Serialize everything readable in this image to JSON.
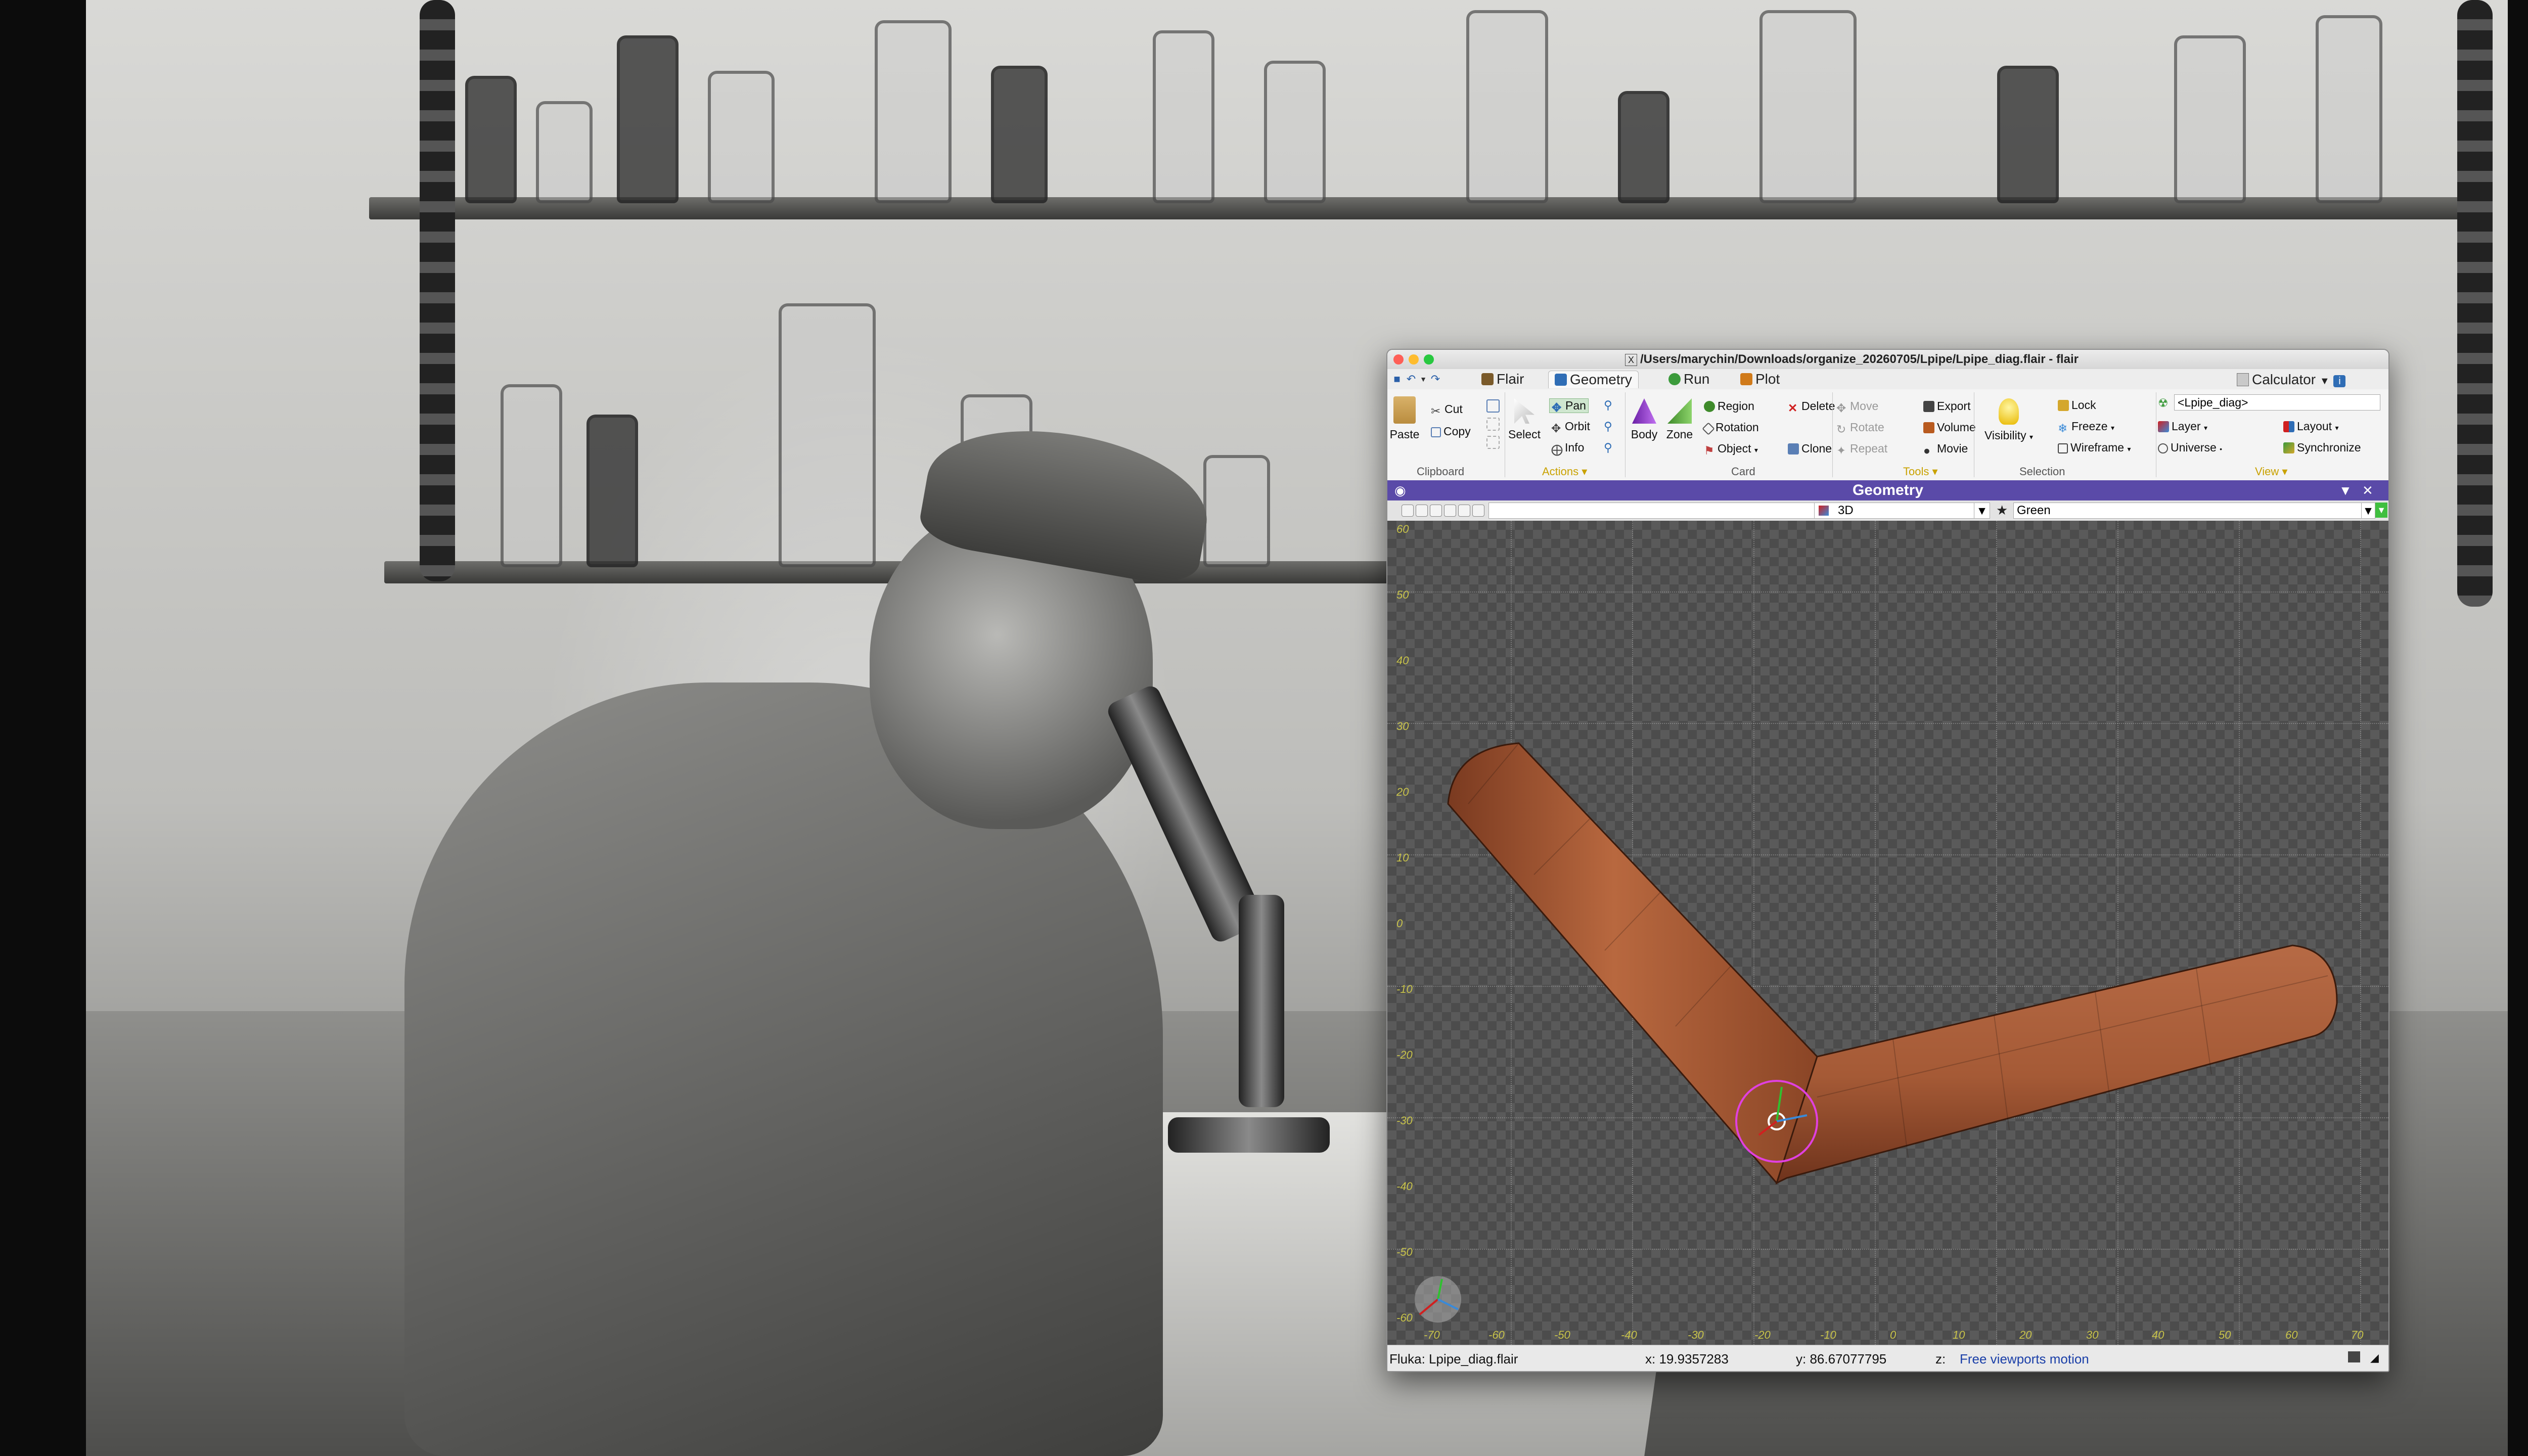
{
  "window": {
    "title": "/Users/marychin/Downloads/organize_20260705/Lpipe/Lpipe_diag.flair - flair",
    "title_icon": "X"
  },
  "menubar": {
    "tabs": [
      {
        "label": "Flair",
        "icon": "flair-icon",
        "color": "#7a5a2a"
      },
      {
        "label": "Geometry",
        "icon": "geometry-icon",
        "color": "#2f6db5",
        "active": true
      },
      {
        "label": "Run",
        "icon": "run-icon",
        "color": "#3b9a3b"
      },
      {
        "label": "Plot",
        "icon": "plot-icon",
        "color": "#d07a1a"
      }
    ],
    "calculator": "Calculator"
  },
  "ribbon": {
    "clipboard": {
      "paste": "Paste",
      "cut": "Cut",
      "copy": "Copy",
      "label": "Clipboard"
    },
    "actions": {
      "select": "Select",
      "pan": "Pan",
      "orbit": "Orbit",
      "info": "Info",
      "label": "Actions"
    },
    "card": {
      "body": "Body",
      "zone": "Zone",
      "region": "Region",
      "rotation": "Rotation",
      "object": "Object",
      "delete": "Delete",
      "clone": "Clone",
      "label": "Card"
    },
    "tools": {
      "move": "Move",
      "rotate": "Rotate",
      "repeat": "Repeat",
      "export": "Export",
      "volume": "Volume",
      "movie": "Movie",
      "label": "Tools"
    },
    "selection": {
      "visibility": "Visibility",
      "lock": "Lock",
      "freeze": "Freeze",
      "wireframe": "Wireframe",
      "label": "Selection"
    },
    "view": {
      "project": "<Lpipe_diag>",
      "layer": "Layer",
      "layout": "Layout",
      "universe": "Universe",
      "synchronize": "Synchronize",
      "label": "View"
    }
  },
  "panel": {
    "title": "Geometry"
  },
  "viewbar": {
    "view_mode": "3D",
    "layer": "Green"
  },
  "viewport": {
    "y_ticks": [
      "60",
      "50",
      "40",
      "30",
      "20",
      "10",
      "0",
      "-10",
      "-20",
      "-30",
      "-40",
      "-50",
      "-60"
    ],
    "x_ticks": [
      "-70",
      "-60",
      "-50",
      "-40",
      "-30",
      "-20",
      "-10",
      "0",
      "10",
      "20",
      "30",
      "40",
      "50",
      "60",
      "70"
    ],
    "pipe_color": "#a85a38"
  },
  "statusbar": {
    "file": "Fluka: Lpipe_diag.flair",
    "x": "x: 19.9357283",
    "y": "y: 86.67077795",
    "z": "z:",
    "mode": "Free viewports motion"
  },
  "colors": {
    "panel_title_bg": "#5a4aa8",
    "tick_color": "#c8c34a",
    "accent_blue": "#2f6db5"
  }
}
